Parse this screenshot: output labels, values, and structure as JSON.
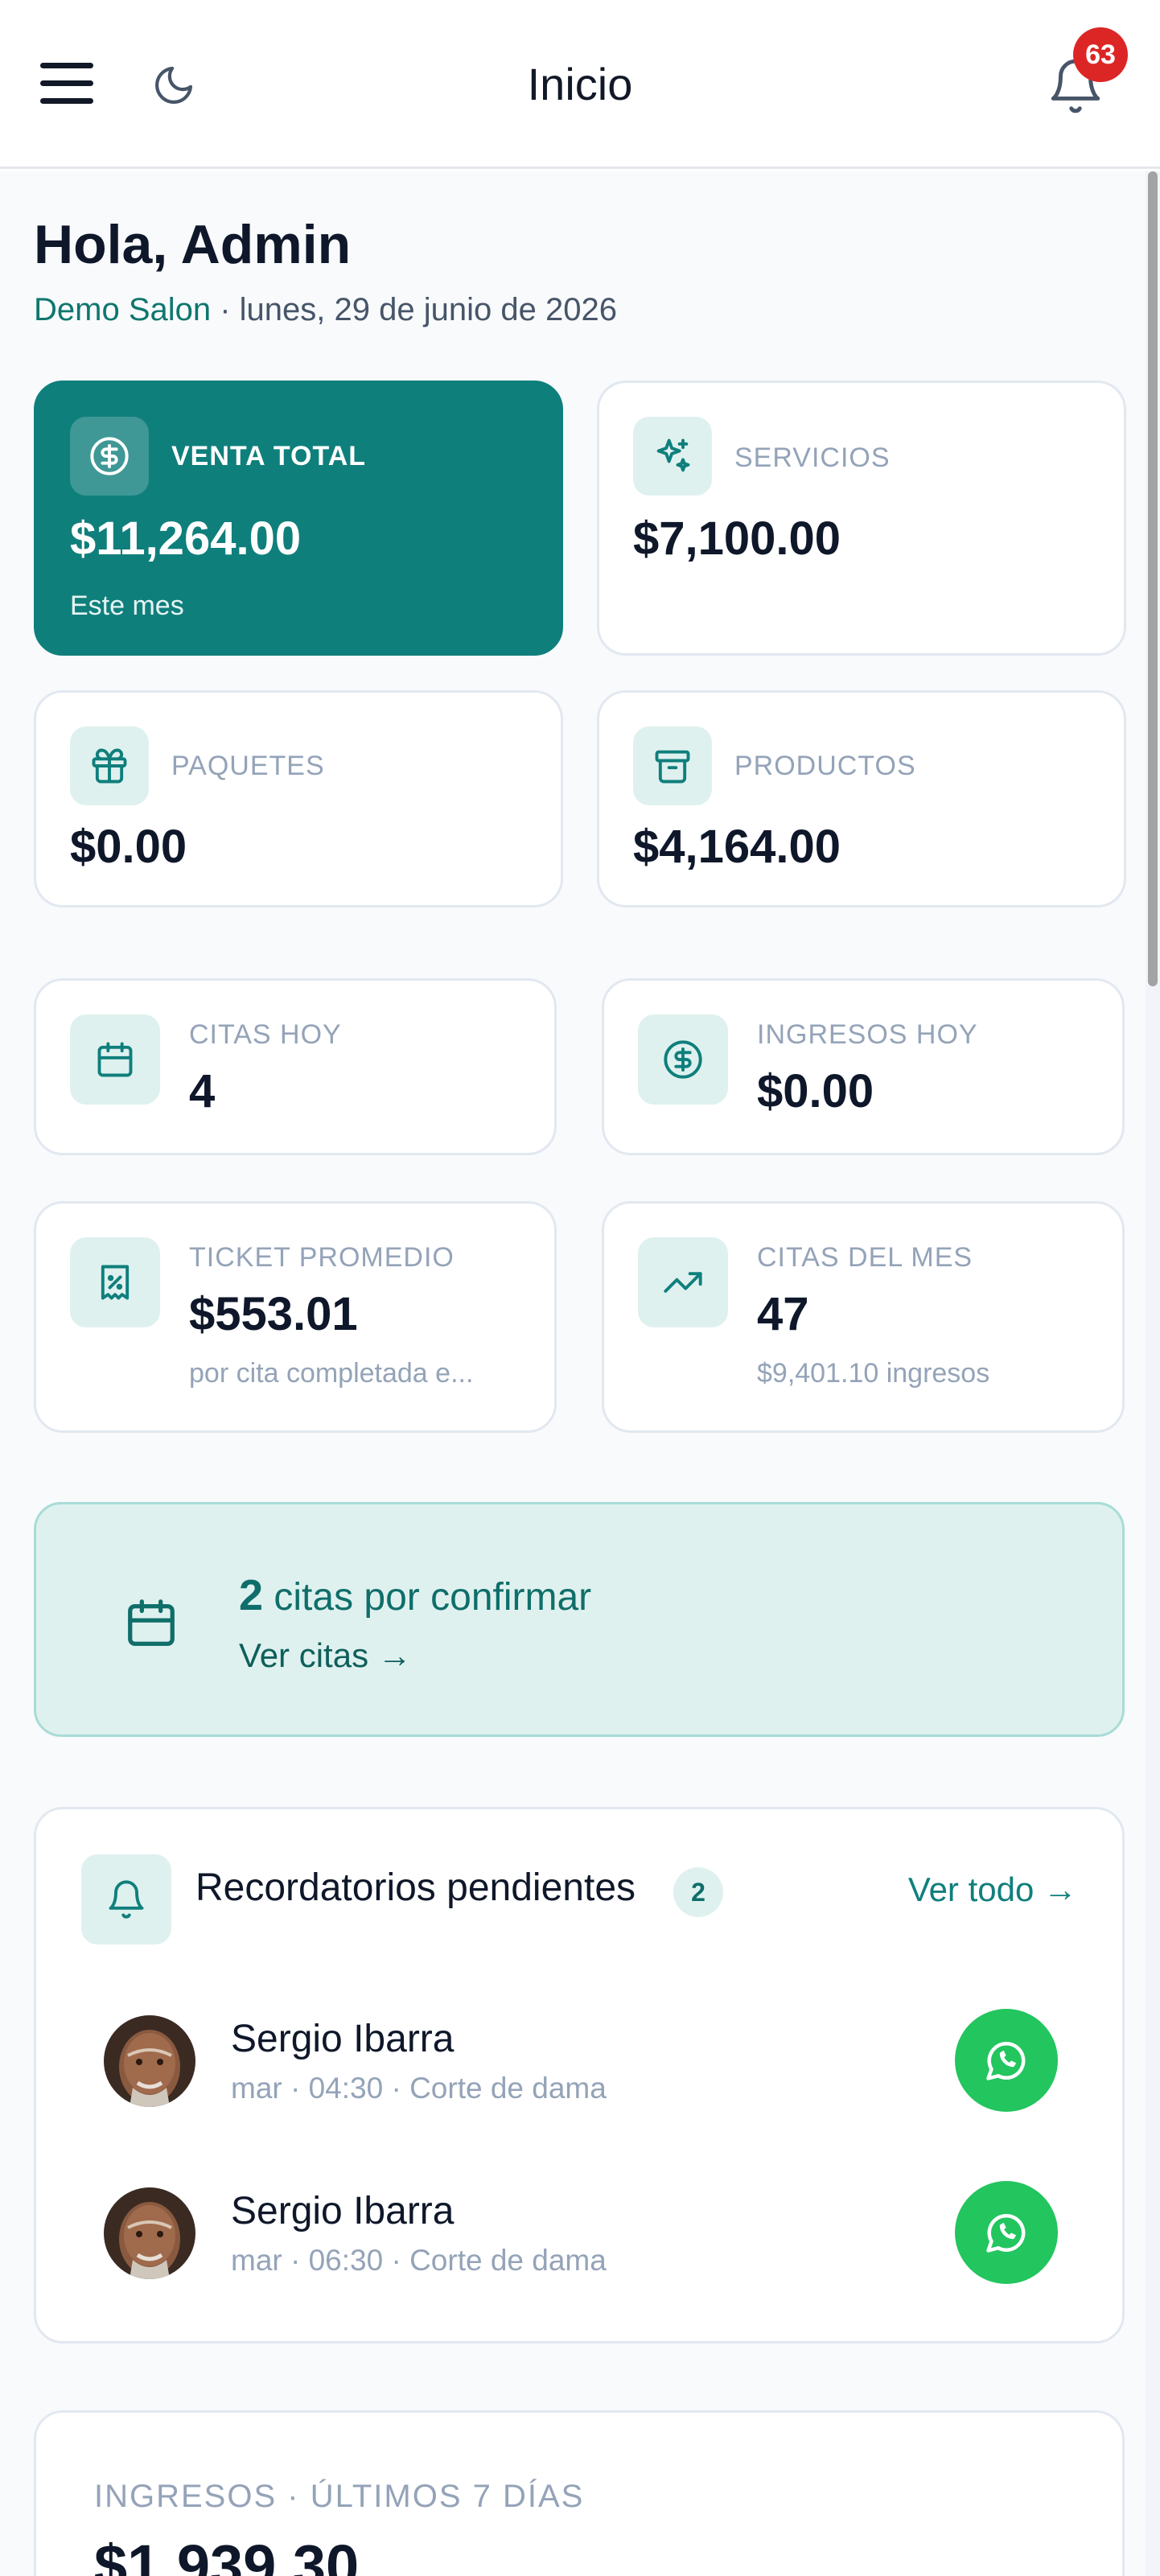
{
  "header": {
    "title": "Inicio",
    "notification_count": "63",
    "menu_icon": "hamburger-menu-icon",
    "theme_icon": "moon-icon",
    "bell_icon": "bell-icon"
  },
  "greeting": {
    "title": "Hola, Admin",
    "salon": "Demo Salon",
    "date": " · lunes, 29 de junio de 2026"
  },
  "sales_cards": [
    {
      "label": "VENTA TOTAL",
      "value": "$11,264.00",
      "note": "Este mes",
      "icon": "dollar-circle-icon"
    },
    {
      "label": "SERVICIOS",
      "value": "$7,100.00",
      "icon": "sparkles-icon"
    },
    {
      "label": "PAQUETES",
      "value": "$0.00",
      "icon": "gift-icon"
    },
    {
      "label": "PRODUCTOS",
      "value": "$4,164.00",
      "icon": "archive-box-icon"
    }
  ],
  "stat_cards": [
    {
      "label": "CITAS HOY",
      "value": "4",
      "icon": "calendar-icon"
    },
    {
      "label": "INGRESOS HOY",
      "value": "$0.00",
      "icon": "dollar-circle-icon"
    },
    {
      "label": "TICKET PROMEDIO",
      "value": "$553.01",
      "note": "por cita completada e...",
      "icon": "receipt-percent-icon"
    },
    {
      "label": "CITAS DEL MES",
      "value": "47",
      "note": "$9,401.10 ingresos",
      "icon": "trending-up-icon"
    }
  ],
  "confirm_banner": {
    "count": "2",
    "text": " citas por confirmar",
    "link": "Ver citas →",
    "icon": "calendar-icon"
  },
  "reminders": {
    "title": "Recordatorios pendientes",
    "count": "2",
    "view_all": "Ver todo →",
    "icon": "bell-icon",
    "items": [
      {
        "name": "Sergio Ibarra",
        "detail": "mar · 04:30 · Corte de dama",
        "action_icon": "whatsapp-icon"
      },
      {
        "name": "Sergio Ibarra",
        "detail": "mar · 06:30 · Corte de dama",
        "action_icon": "whatsapp-icon"
      }
    ]
  },
  "income": {
    "label": "INGRESOS · ÚLTIMOS 7 DÍAS",
    "value": "$1,939.30"
  },
  "colors": {
    "brand": "#0f7f7c",
    "brand_light": "#dff1ef",
    "badge_red": "#dc2626",
    "whatsapp_green": "#22c55e"
  }
}
